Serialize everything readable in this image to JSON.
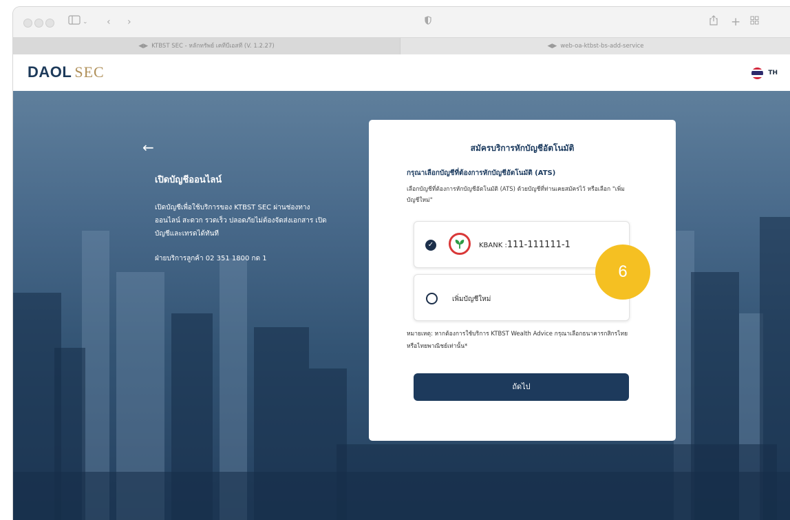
{
  "browser": {
    "tabs": [
      {
        "label": "KTBST SEC - หลักทรัพย์ เคทีบีเอสที (V. 1.2.27)",
        "active": true
      },
      {
        "label": "web-oa-ktbst-bs-add-service",
        "active": false
      }
    ]
  },
  "header": {
    "logo_primary": "DAOL",
    "logo_secondary": "SEC",
    "language": "TH"
  },
  "left_panel": {
    "title": "เปิดบัญชีออนไลน์",
    "description": "เปิดบัญชีเพื่อใช้บริการของ KTBST SEC ผ่านช่องทางออนไลน์ สะดวก รวดเร็ว ปลอดภัยไม่ต้องจัดส่งเอกสาร เปิดบัญชีและเทรดได้ทันที",
    "contact": "ฝ่ายบริการลูกค้า 02 351 1800 กด 1"
  },
  "form": {
    "title": "สมัครบริการหักบัญชีอัตโนมัติ",
    "subtitle": "กรุณาเลือกบัญชีที่ต้องการหักบัญชีอัตโนมัติ (ATS)",
    "description": "เลือกบัญชีที่ต้องการหักบัญชีอัตโนมัติ (ATS) ด้วยบัญชีที่ท่านเคยสมัครไว้ หรือเลือก \"เพิ่มบัญชีใหม่\"",
    "options": [
      {
        "bank_prefix": "KBANK :",
        "account": "111-111111-1",
        "selected": true
      },
      {
        "label": "เพิ่มบัญชีใหม่",
        "selected": false
      }
    ],
    "note": "หมายเหตุ: หากต้องการใช้บริการ KTBST Wealth Advice กรุณาเลือกธนาคารกสิกรไทย หรือไทยพาณิชย์เท่านั้น*",
    "next_label": "ถัดไป"
  },
  "step_badge": "6",
  "colors": {
    "navy": "#1d3a5c",
    "gold": "#b0905a",
    "badge": "#f5c022",
    "kbank_red": "#d93838",
    "kbank_green": "#2e9b45"
  }
}
